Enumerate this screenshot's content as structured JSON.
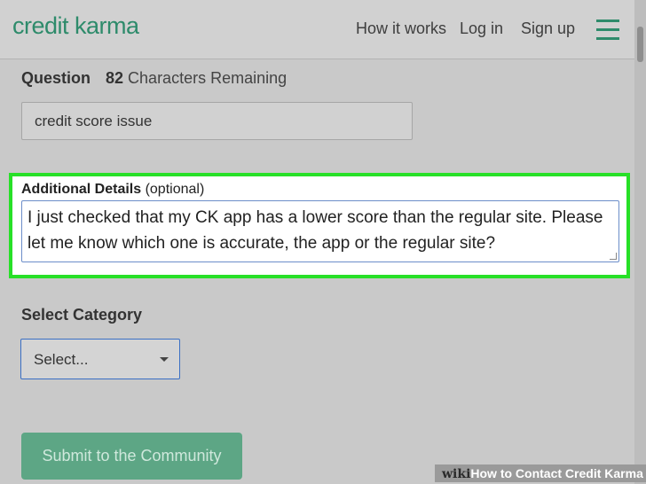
{
  "header": {
    "logo": "credit karma",
    "nav": {
      "how_it_works": "How it works",
      "log_in": "Log in",
      "sign_up": "Sign up"
    },
    "menu_icon": "hamburger-menu-icon"
  },
  "question": {
    "label": "Question",
    "remaining_count": "82",
    "remaining_text": "Characters Remaining",
    "value": "credit score issue"
  },
  "details": {
    "label": "Additional Details",
    "optional": "(optional)",
    "value": "I just checked that my CK app has a lower score than the regular site. Please let me know which one is accurate, the app or the regular site?"
  },
  "category": {
    "label": "Select Category",
    "selected": "Select...",
    "caret_icon": "caret-down-icon"
  },
  "submit": {
    "label": "Submit to the Community"
  },
  "watermark": {
    "brand": "wiki",
    "title": "How to Contact Credit Karma"
  },
  "colors": {
    "brand_green": "#2e8b6b",
    "highlight_green": "#27e027",
    "submit_green": "#5da685",
    "focus_blue": "#3a6fc4"
  }
}
